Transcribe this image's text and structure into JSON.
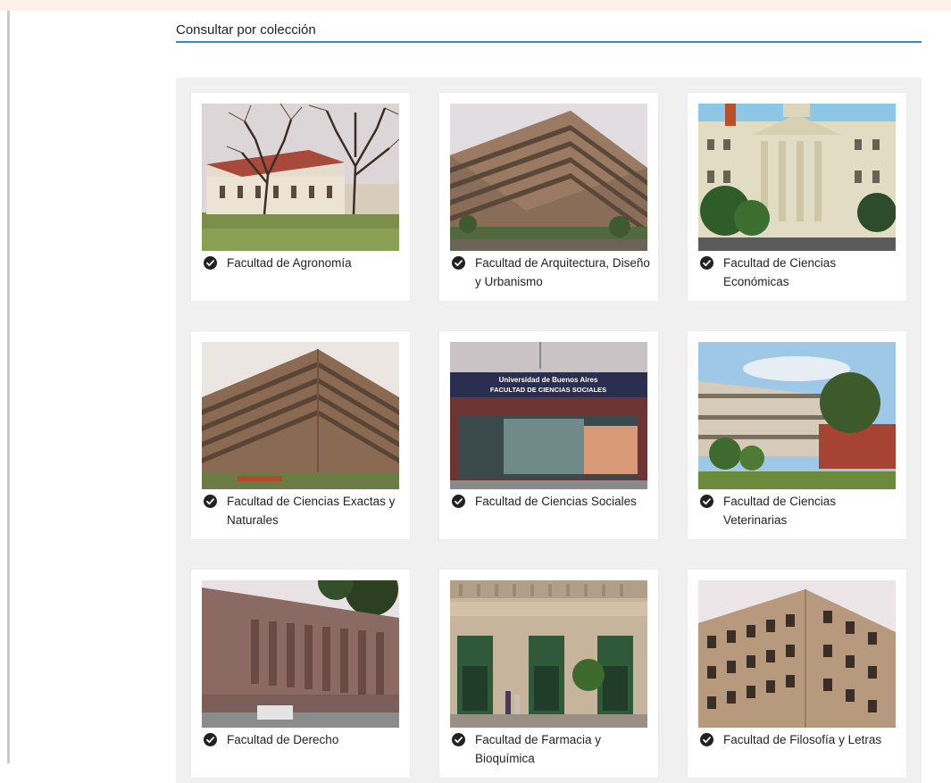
{
  "section": {
    "title": "Consultar por colección"
  },
  "collections": [
    {
      "name": "Facultad de Agronomía"
    },
    {
      "name": "Facultad de Arquitectura, Diseño y Urbanismo"
    },
    {
      "name": "Facultad de Ciencias Económicas"
    },
    {
      "name": "Facultad de Ciencias Exactas y Naturales"
    },
    {
      "name": "Facultad de Ciencias Sociales",
      "photo_sign": [
        "Universidad de Buenos Aires",
        "FACULTAD DE CIENCIAS SOCIALES"
      ]
    },
    {
      "name": "Facultad de Ciencias Veterinarias"
    },
    {
      "name": "Facultad de Derecho"
    },
    {
      "name": "Facultad de Farmacia y Bioquímica"
    },
    {
      "name": "Facultad de Filosofía y Letras"
    }
  ],
  "icons": {
    "selected_marker": "check-circle-icon"
  },
  "colors": {
    "accent_rule": "#2a8fc9",
    "panel_bg": "#f0f0f0"
  }
}
